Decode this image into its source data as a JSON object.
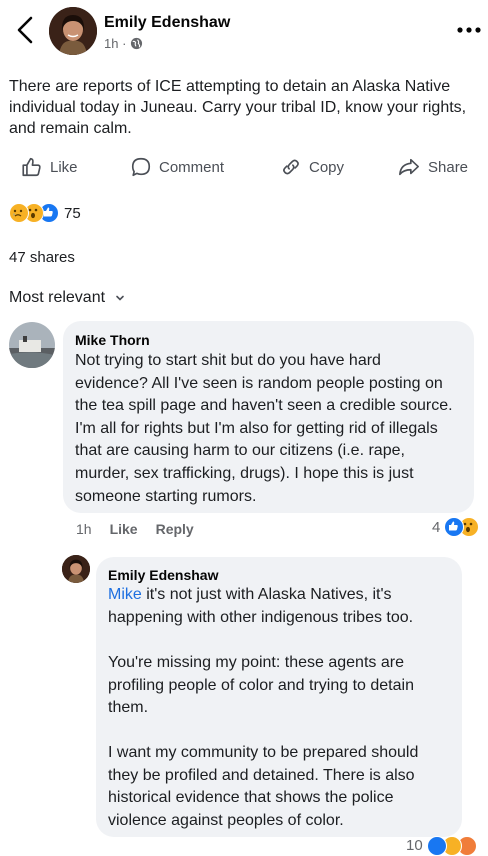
{
  "header": {
    "author": "Emily Edenshaw",
    "time": "1h ·"
  },
  "post": {
    "text": "There are reports of ICE attempting to detain an Alaska Native individual today in Juneau. Carry your tribal ID, know your rights, and remain calm."
  },
  "actions": {
    "like": "Like",
    "comment": "Comment",
    "copy": "Copy",
    "share": "Share"
  },
  "reactions": {
    "count": "75",
    "types": [
      "sad",
      "wow",
      "like"
    ]
  },
  "shares": "47 shares",
  "sort": {
    "label": "Most relevant"
  },
  "comments": [
    {
      "author": "Mike Thorn",
      "text": "Not trying to start shit but do you have hard evidence? All I've seen is random people posting on the tea spill page and haven't seen a credible source. I'm all for rights but I'm also for getting rid of illegals that are causing harm to our citizens (i.e. rape, murder, sex trafficking, drugs). I hope this is just someone starting rumors.",
      "time": "1h",
      "like": "Like",
      "reply": "Reply",
      "reaction_count": "4"
    },
    {
      "author": "Emily Edenshaw",
      "mention": "Mike",
      "text_line1": " it's not just with Alaska Natives, it's happening with other indigenous tribes too.",
      "text_para2": "You're missing my point: these agents are profiling people of color and trying to detain them.",
      "text_para3": "I want my community to be prepared should they be profiled and detained. There is also historical evidence that shows the police violence against peoples of color.",
      "reaction_count": "10"
    }
  ],
  "colors": {
    "like_blue": "#1877f2",
    "mention": "#1d6fe0",
    "bubble": "#f0f2f5",
    "secondary_text": "#65676b"
  }
}
